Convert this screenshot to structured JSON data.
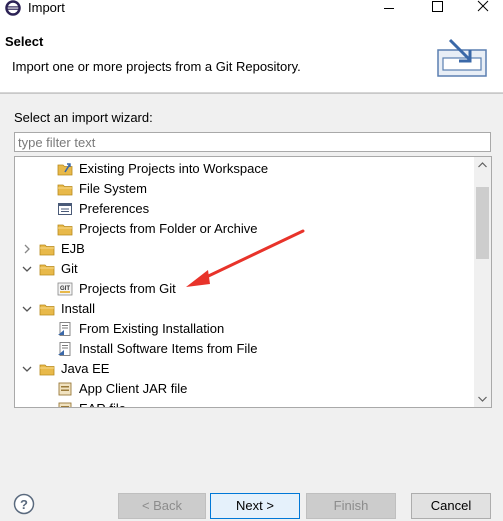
{
  "window": {
    "title": "Import"
  },
  "header": {
    "title": "Select",
    "description": "Import one or more projects from a Git Repository."
  },
  "wizard": {
    "label": "Select an import wizard:",
    "filter_placeholder": "type filter text",
    "tree": [
      {
        "label": "Existing Projects into Workspace",
        "icon": "existing-projects-icon",
        "indent": 2
      },
      {
        "label": "File System",
        "icon": "folder-icon",
        "indent": 2
      },
      {
        "label": "Preferences",
        "icon": "preferences-icon",
        "indent": 2
      },
      {
        "label": "Projects from Folder or Archive",
        "icon": "folder-icon",
        "indent": 2
      },
      {
        "label": "EJB",
        "icon": "folder-icon",
        "indent": 0,
        "expander": "collapsed"
      },
      {
        "label": "Git",
        "icon": "folder-icon",
        "indent": 0,
        "expander": "expanded"
      },
      {
        "label": "Projects from Git",
        "icon": "git-icon",
        "indent": 2,
        "selected": true
      },
      {
        "label": "Install",
        "icon": "folder-icon",
        "indent": 0,
        "expander": "expanded"
      },
      {
        "label": "From Existing Installation",
        "icon": "install-icon",
        "indent": 2
      },
      {
        "label": "Install Software Items from File",
        "icon": "install-icon",
        "indent": 2
      },
      {
        "label": "Java EE",
        "icon": "folder-icon",
        "indent": 0,
        "expander": "expanded"
      },
      {
        "label": "App Client JAR file",
        "icon": "jar-icon",
        "indent": 2
      },
      {
        "label": "EAR file",
        "icon": "jar-icon",
        "indent": 2
      }
    ]
  },
  "footer": {
    "back_label": "< Back",
    "next_label": "Next >",
    "finish_label": "Finish",
    "cancel_label": "Cancel"
  },
  "colors": {
    "annotation_arrow": "#e8332a",
    "folder": "#e8b94a",
    "accent": "#0078d7"
  }
}
